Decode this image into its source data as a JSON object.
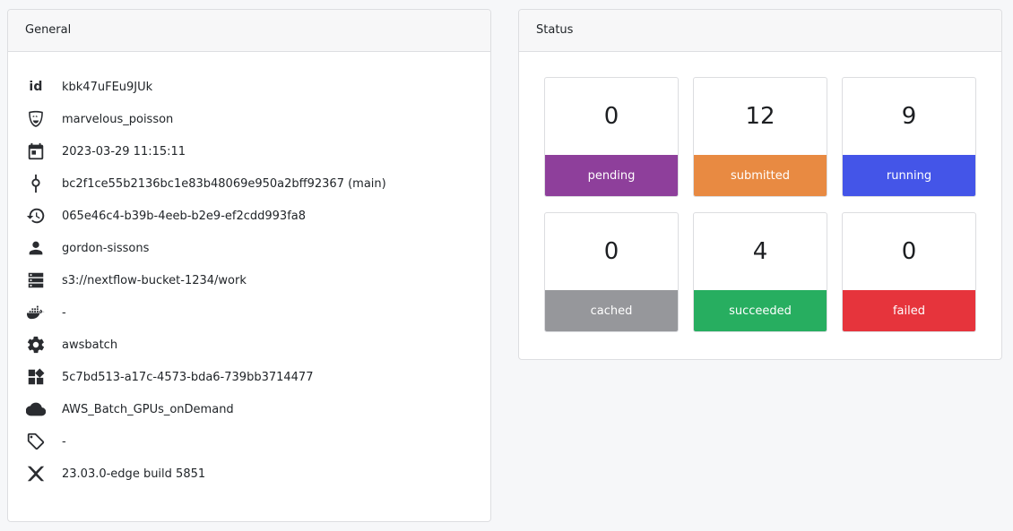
{
  "general": {
    "title": "General",
    "rows": [
      {
        "icon": "id-icon",
        "value": "kbk47uFEu9JUk"
      },
      {
        "icon": "mask-icon",
        "value": "marvelous_poisson"
      },
      {
        "icon": "calendar-icon",
        "value": "2023-03-29 11:15:11"
      },
      {
        "icon": "commit-icon",
        "value": "bc2f1ce55b2136bc1e83b48069e950a2bff92367 (main)"
      },
      {
        "icon": "history-icon",
        "value": "065e46c4-b39b-4eeb-b2e9-ef2cdd993fa8"
      },
      {
        "icon": "user-icon",
        "value": "gordon-sissons"
      },
      {
        "icon": "server-icon",
        "value": "s3://nextflow-bucket-1234/work"
      },
      {
        "icon": "docker-icon",
        "value": "-"
      },
      {
        "icon": "gear-icon",
        "value": "awsbatch"
      },
      {
        "icon": "widgets-icon",
        "value": "5c7bd513-a17c-4573-bda6-739bb3714477"
      },
      {
        "icon": "cloud-icon",
        "value": "AWS_Batch_GPUs_onDemand"
      },
      {
        "icon": "tags-icon",
        "value": "-"
      },
      {
        "icon": "nextflow-icon",
        "value": "23.03.0-edge build 5851"
      }
    ],
    "id_glyph": "id"
  },
  "status": {
    "title": "Status",
    "tiles": [
      {
        "count": "0",
        "label": "pending",
        "color": "#8e3f9b"
      },
      {
        "count": "12",
        "label": "submitted",
        "color": "#e88a42"
      },
      {
        "count": "9",
        "label": "running",
        "color": "#4455e8"
      },
      {
        "count": "0",
        "label": "cached",
        "color": "#96979b"
      },
      {
        "count": "4",
        "label": "succeeded",
        "color": "#27ae60"
      },
      {
        "count": "0",
        "label": "failed",
        "color": "#e6343c"
      }
    ]
  }
}
